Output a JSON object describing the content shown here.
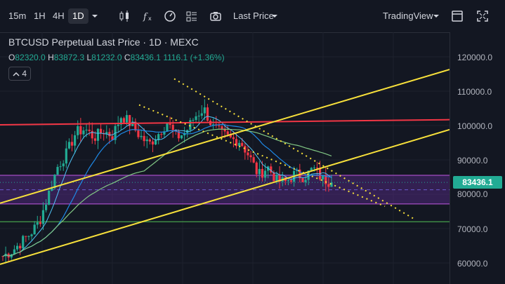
{
  "toolbar": {
    "intervals": [
      "15m",
      "1H",
      "4H",
      "1D"
    ],
    "active_interval": "1D",
    "price_type": "Last Price",
    "tradingview": "TradingView"
  },
  "legend": {
    "title": "BTCUSD Perpetual Last Price · 1D · MEXC",
    "o_label": "O",
    "o": "82320.0",
    "h_label": "H",
    "h": "83872.3",
    "l_label": "L",
    "l": "81232.0",
    "c_label": "C",
    "c": "83436.1",
    "change": "1116.1 (+1.36%)",
    "indicators_count": "4"
  },
  "price_axis": {
    "labels": [
      "120000.0",
      "110000.0",
      "100000.0",
      "90000.0",
      "80000.0",
      "70000.0",
      "60000.0"
    ],
    "current_price": "83436.1",
    "current_price_color": "#22ab94"
  },
  "chart_data": {
    "type": "candlestick",
    "symbol": "BTCUSD Perpetual",
    "interval": "1D",
    "exchange": "MEXC",
    "ylim": [
      55000,
      125000
    ],
    "last_close": 83436.1,
    "close_path": [
      62000,
      63500,
      66000,
      68500,
      72000,
      80000,
      88000,
      92000,
      98000,
      99000,
      96500,
      98500,
      97000,
      103000,
      100500,
      97000,
      94500,
      97500,
      101000,
      96500,
      98000,
      102500,
      105000,
      99500,
      97500,
      96000,
      95500,
      91000,
      85500,
      88000,
      84000,
      83500,
      86000,
      85000,
      87500,
      84500,
      83436
    ],
    "horizontal_levels": [
      72000
    ],
    "colors": {
      "up": "#22ab94",
      "down": "#f23645",
      "trend_lines": "#f7e03b",
      "resistance": "#f23645",
      "support": "#4caf50",
      "zone": "#5b2c8f"
    }
  }
}
